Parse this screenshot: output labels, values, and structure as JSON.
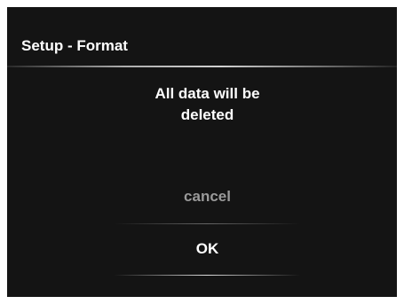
{
  "dialog": {
    "title": "Setup - Format",
    "message_line1": "All data will be",
    "message_line2": "deleted"
  },
  "options": {
    "cancel_label": "cancel",
    "ok_label": "OK",
    "selected": "OK"
  },
  "colors": {
    "background": "#141414",
    "text": "#ffffff",
    "inactive_option": "#9a9a9a"
  }
}
